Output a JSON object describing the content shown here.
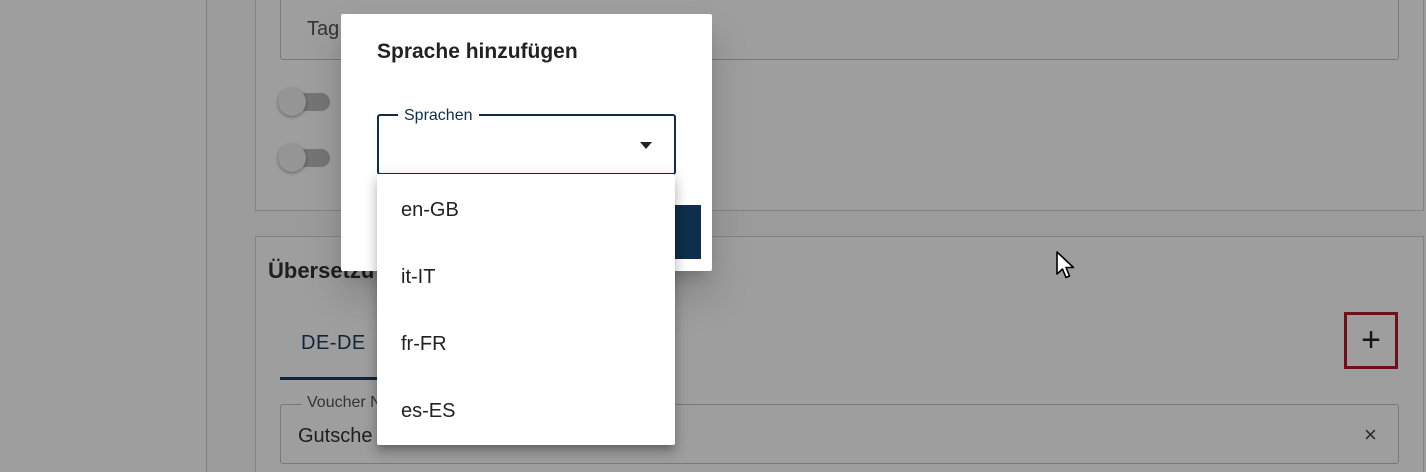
{
  "background": {
    "tags_field_text": "Tag",
    "section_title": "Übersetzu",
    "tabs": [
      {
        "label": "DE-DE"
      }
    ],
    "add_button": {
      "symbol": "+"
    },
    "voucher_field": {
      "legend": "Voucher N",
      "value": "Gutsche",
      "clear_symbol": "×"
    }
  },
  "dialog": {
    "title": "Sprache hinzufügen",
    "select": {
      "label": "Sprachen",
      "value": ""
    },
    "options": [
      {
        "label": "en-GB"
      },
      {
        "label": "it-IT"
      },
      {
        "label": "fr-FR"
      },
      {
        "label": "es-ES"
      }
    ]
  },
  "colors": {
    "primary": "#0e2e4c",
    "highlight": "#b01a2a",
    "scrim": "rgba(0,0,0,0.38)"
  },
  "icons": {
    "select_arrow": "caret-down-icon",
    "add": "plus-icon",
    "clear": "close-icon",
    "cursor": "mouse-pointer-icon"
  }
}
